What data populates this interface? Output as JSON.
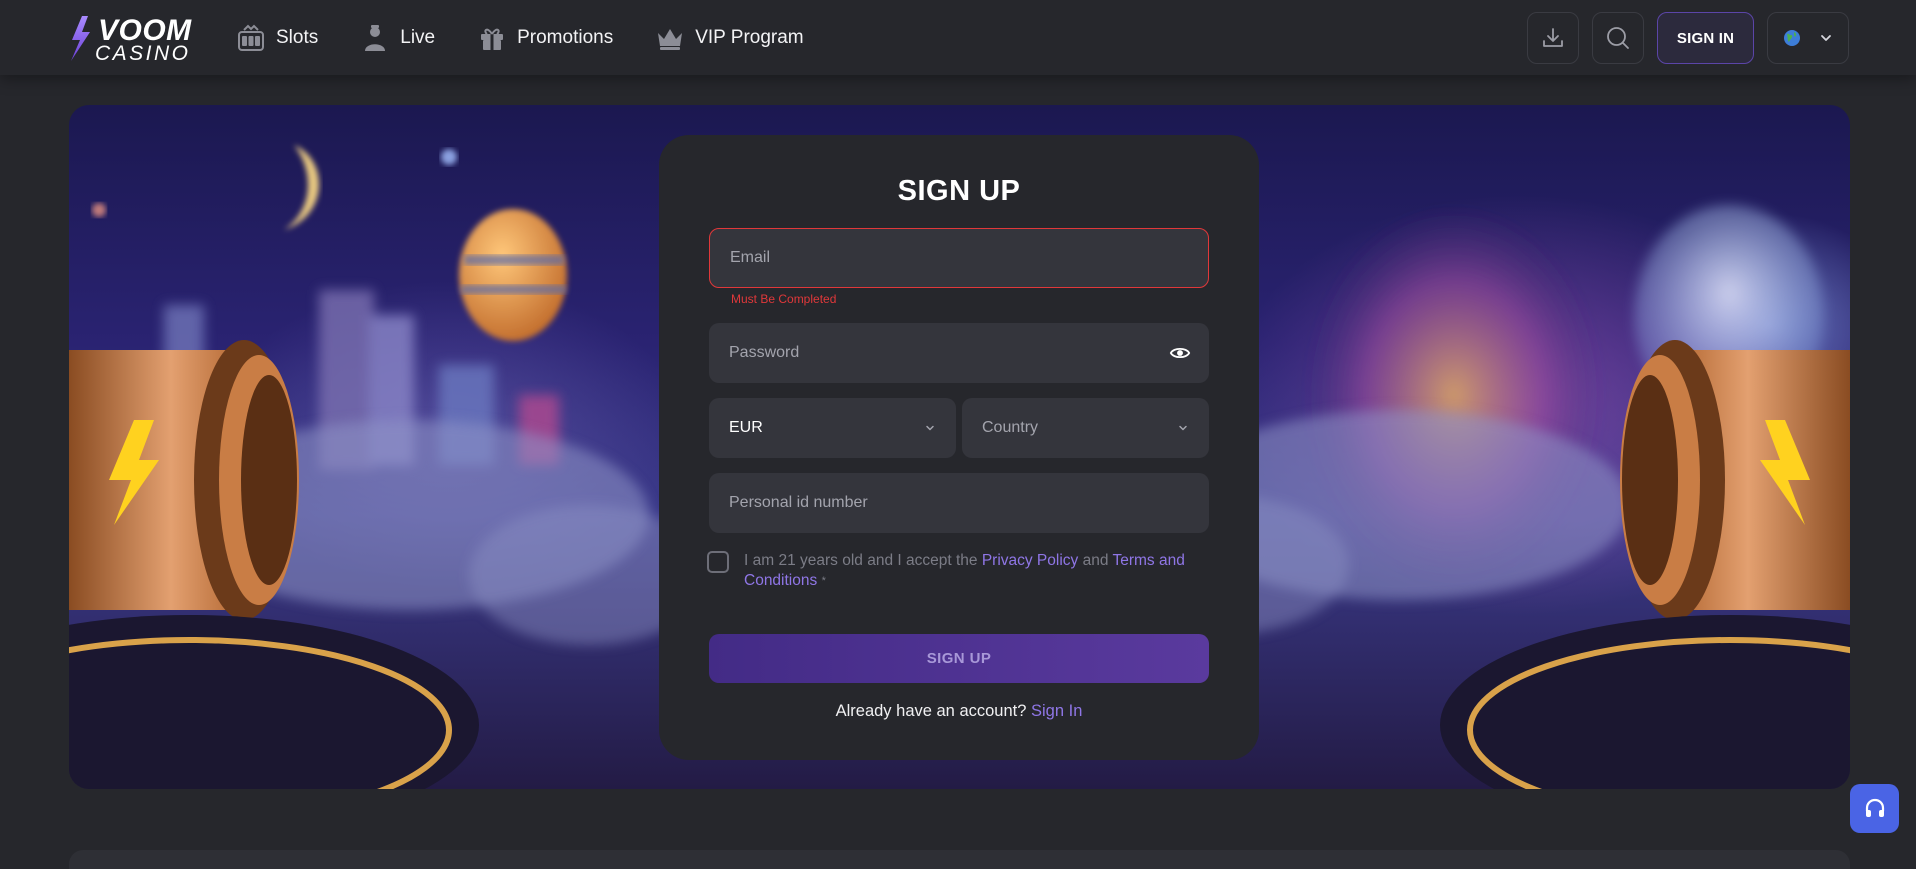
{
  "brand": {
    "logo_line1": "VOOM",
    "logo_line2": "CASINO",
    "accent_color": "#8f76e6",
    "error_color": "#e0383a"
  },
  "nav": {
    "items": [
      {
        "label": "Slots",
        "icon": "slot-machine-icon"
      },
      {
        "label": "Live",
        "icon": "dealer-icon"
      },
      {
        "label": "Promotions",
        "icon": "gift-icon"
      },
      {
        "label": "VIP Program",
        "icon": "crown-icon"
      }
    ]
  },
  "header_actions": {
    "download_icon": "download-icon",
    "search_icon": "search-icon",
    "signin_label": "SIGN IN",
    "language_icon": "globe-icon"
  },
  "signup": {
    "title": "SIGN UP",
    "email": {
      "placeholder": "Email",
      "value": "",
      "error": "Must Be Completed"
    },
    "password": {
      "placeholder": "Password",
      "value": ""
    },
    "currency": {
      "selected": "EUR"
    },
    "country": {
      "placeholder": "Country"
    },
    "personal_id": {
      "placeholder": "Personal id number",
      "value": ""
    },
    "terms": {
      "prefix": "I am 21 years old and I accept the ",
      "privacy_link": "Privacy Policy",
      "middle": " and ",
      "terms_link": "Terms and Conditions",
      "required_mark": "*",
      "checked": false
    },
    "submit_label": "SIGN UP",
    "already_text": "Already have an account?",
    "signin_link": "Sign In"
  },
  "support": {
    "icon": "headset-icon"
  }
}
